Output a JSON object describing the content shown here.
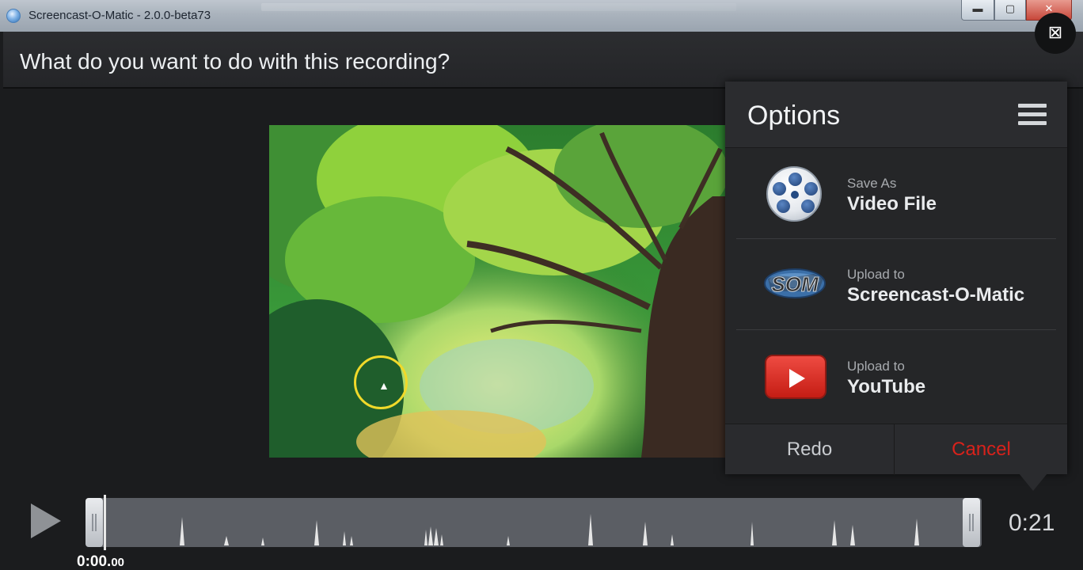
{
  "window": {
    "title": "Screencast-O-Matic - 2.0.0-beta73",
    "buttons": {
      "minimize": "▬",
      "maximize": "▢",
      "close": "✕"
    }
  },
  "overlay_badge": "⊠",
  "prompt": "What do you want to do with this recording?",
  "options_panel": {
    "title": "Options",
    "menu_icon": "hamburger-menu-icon",
    "items": [
      {
        "action": "Save As",
        "target": "Video File",
        "icon": "film-reel-icon"
      },
      {
        "action": "Upload to",
        "target": "Screencast-O-Matic",
        "icon": "som-logo-icon"
      },
      {
        "action": "Upload to",
        "target": "YouTube",
        "icon": "youtube-icon"
      }
    ],
    "redo_label": "Redo",
    "cancel_label": "Cancel",
    "cancel_color": "#d8221b"
  },
  "timeline": {
    "duration": "0:21",
    "current_time_main": "0:00.",
    "current_time_frac": "00",
    "play_icon": "play-icon"
  }
}
